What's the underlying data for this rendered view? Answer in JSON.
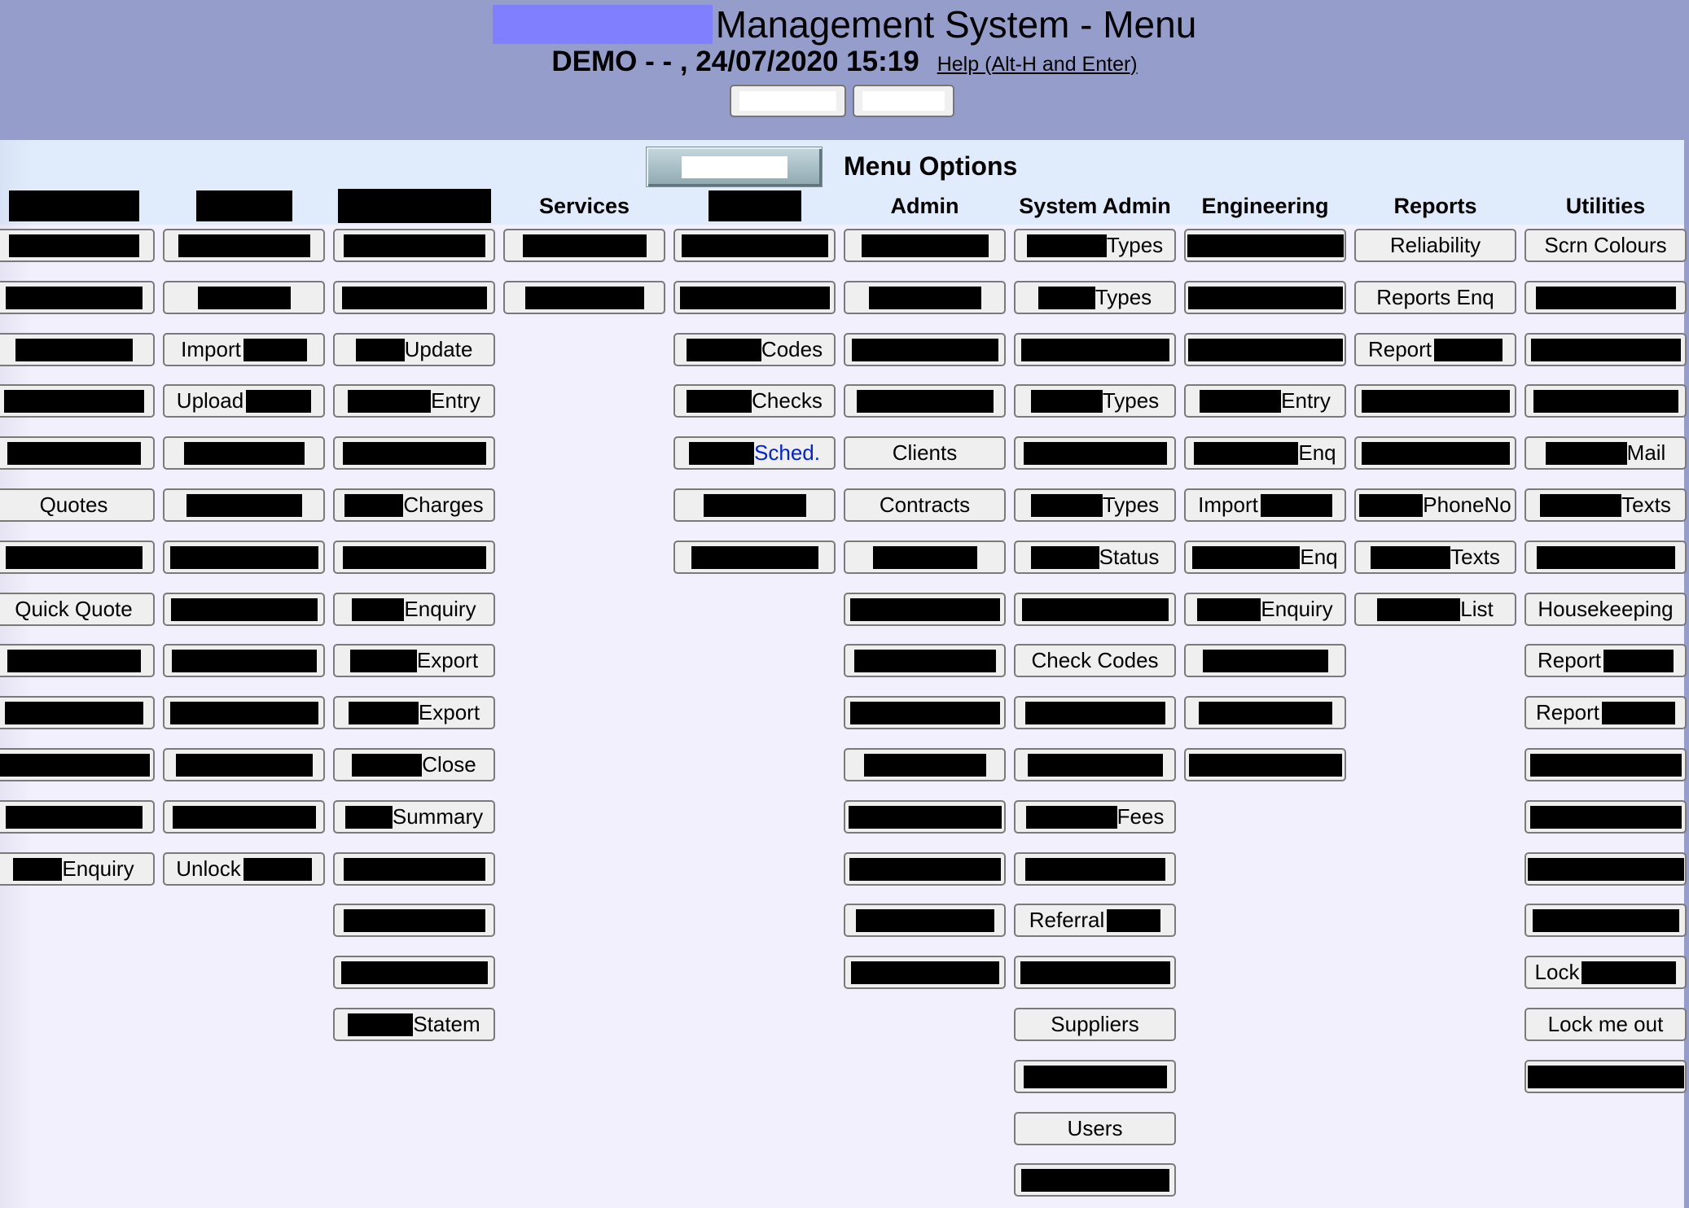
{
  "header": {
    "title": "Management System - Menu",
    "subtitle": "DEMO - - , 24/07/2020 15:19",
    "help_link": "Help (Alt-H and Enter)",
    "buttons": [
      {
        "label": "",
        "redacted": true
      },
      {
        "label": "",
        "redacted": true
      }
    ]
  },
  "panel": {
    "heading": "Menu Options",
    "image_button_label": ""
  },
  "colors": {
    "header_bg": "#959ecb",
    "title_redaction": "#8080ff",
    "panel_top_bg": "#e0ecfc",
    "panel_body_bg": "#f2f0fc",
    "button_bg": "#efefef",
    "link_text": "#0020e0"
  },
  "columns": [
    {
      "header": null,
      "header_redact_w": 160,
      "items": [
        {
          "pre": 0,
          "text": "",
          "post": 0,
          "full": 160
        },
        {
          "full": 168
        },
        {
          "full": 144
        },
        {
          "full": 172
        },
        {
          "full": 164
        },
        {
          "text": "Quotes"
        },
        {
          "full": 168
        },
        {
          "text": "Quick Quote"
        },
        {
          "full": 164
        },
        {
          "full": 170
        },
        {
          "full": 186
        },
        {
          "full": 168
        },
        {
          "pre": 60,
          "text": "Enquiry"
        }
      ]
    },
    {
      "header": null,
      "header_redact_w": 118,
      "items": [
        {
          "full": 162
        },
        {
          "full": 114
        },
        {
          "text": "Import",
          "post": 78
        },
        {
          "text": "Upload",
          "post": 80
        },
        {
          "full": 148
        },
        {
          "full": 142
        },
        {
          "full": 182
        },
        {
          "full": 180
        },
        {
          "full": 178
        },
        {
          "full": 182
        },
        {
          "full": 168
        },
        {
          "full": 176
        },
        {
          "text": "Unlock",
          "post": 84
        }
      ]
    },
    {
      "header": null,
      "header_redact_w": 188,
      "items": [
        {
          "full": 174
        },
        {
          "full": 178
        },
        {
          "pre": 60,
          "text": "Update"
        },
        {
          "pre": 102,
          "text": "Entry"
        },
        {
          "full": 176
        },
        {
          "pre": 72,
          "text": "Charges"
        },
        {
          "full": 176
        },
        {
          "pre": 64,
          "text": "Enquiry"
        },
        {
          "pre": 82,
          "text": "Export"
        },
        {
          "pre": 86,
          "text": "Export"
        },
        {
          "pre": 86,
          "text": "Close"
        },
        {
          "pre": 58,
          "text": "Summary"
        },
        {
          "full": 174
        },
        {
          "full": 174
        },
        {
          "full": 180
        },
        {
          "pre": 80,
          "text": "Statem"
        }
      ]
    },
    {
      "header": "Services",
      "items": [
        {
          "full": 152
        },
        {
          "full": 146
        }
      ]
    },
    {
      "header": null,
      "header_redact_w": 114,
      "items": [
        {
          "full": 180
        },
        {
          "full": 184
        },
        {
          "pre": 92,
          "text": "Codes"
        },
        {
          "pre": 80,
          "text": "Checks"
        },
        {
          "pre": 80,
          "text": "Sched.",
          "link": true
        },
        {
          "full": 126
        },
        {
          "full": 156
        }
      ]
    },
    {
      "header": "Admin",
      "items": [
        {
          "full": 156
        },
        {
          "full": 138
        },
        {
          "full": 180
        },
        {
          "full": 168
        },
        {
          "text": "Clients"
        },
        {
          "text": "Contracts"
        },
        {
          "full": 128
        },
        {
          "full": 184
        },
        {
          "full": 174
        },
        {
          "full": 184
        },
        {
          "full": 150
        },
        {
          "full": 188
        },
        {
          "full": 186
        },
        {
          "full": 170
        },
        {
          "full": 182
        }
      ]
    },
    {
      "header": "System Admin",
      "items": [
        {
          "pre": 98,
          "text": "Types"
        },
        {
          "pre": 70,
          "text": "Types"
        },
        {
          "full": 182
        },
        {
          "pre": 88,
          "text": "Types"
        },
        {
          "full": 176
        },
        {
          "pre": 88,
          "text": "Types"
        },
        {
          "pre": 84,
          "text": "Status"
        },
        {
          "full": 180
        },
        {
          "text": "Check Codes"
        },
        {
          "full": 172
        },
        {
          "full": 166
        },
        {
          "pre": 112,
          "text": "Fees"
        },
        {
          "full": 172
        },
        {
          "text": "Referral",
          "post": 66
        },
        {
          "full": 184
        },
        {
          "text": "Suppliers"
        },
        {
          "full": 176
        },
        {
          "text": "Users"
        },
        {
          "full": 182
        }
      ]
    },
    {
      "header": "Engineering",
      "items": [
        {
          "full": 192
        },
        {
          "full": 190
        },
        {
          "full": 190
        },
        {
          "pre": 100,
          "text": "Entry"
        },
        {
          "pre": 128,
          "text": "Enq"
        },
        {
          "text": "Import",
          "post": 88
        },
        {
          "pre": 132,
          "text": "Enq"
        },
        {
          "pre": 78,
          "text": "Enquiry"
        },
        {
          "full": 154
        },
        {
          "full": 164
        },
        {
          "full": 188
        }
      ]
    },
    {
      "header": "Reports",
      "items": [
        {
          "text": "Reliability"
        },
        {
          "text": "Reports Enq"
        },
        {
          "text": "Report",
          "post": 84
        },
        {
          "full": 182
        },
        {
          "full": 182
        },
        {
          "pre": 78,
          "text": "PhoneNo"
        },
        {
          "pre": 98,
          "text": "Texts"
        },
        {
          "pre": 102,
          "text": "List"
        }
      ]
    },
    {
      "header": "Utilities",
      "items": [
        {
          "text": "Scrn Colours"
        },
        {
          "full": 172
        },
        {
          "full": 184
        },
        {
          "full": 178
        },
        {
          "pre": 100,
          "text": "Mail"
        },
        {
          "pre": 100,
          "text": "Texts"
        },
        {
          "full": 170
        },
        {
          "text": "Housekeeping"
        },
        {
          "text": "Report",
          "post": 86
        },
        {
          "text": "Report",
          "post": 90
        },
        {
          "full": 186
        },
        {
          "full": 186
        },
        {
          "full": 192
        },
        {
          "full": 180
        },
        {
          "text": "Lock",
          "post": 116
        },
        {
          "text": "Lock me out"
        },
        {
          "full": 192
        }
      ]
    }
  ]
}
